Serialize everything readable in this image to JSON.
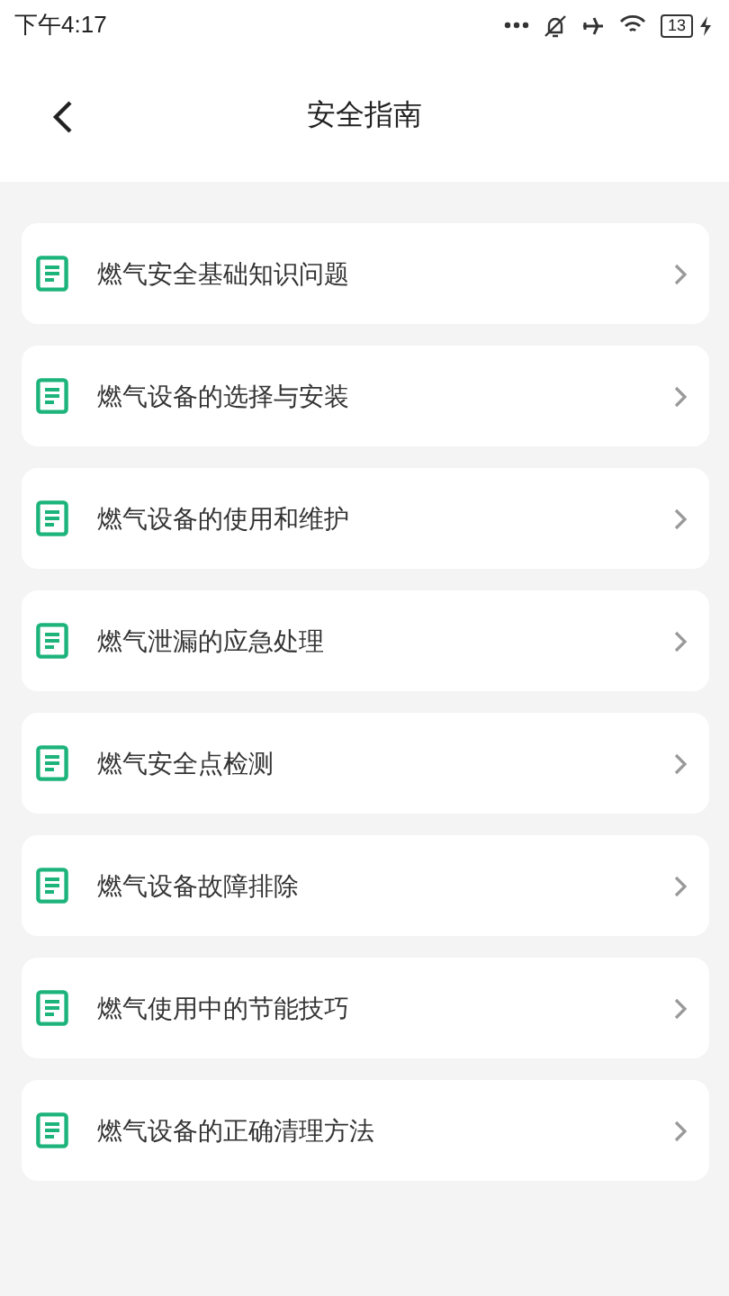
{
  "status_bar": {
    "time": "下午4:17",
    "battery": "13"
  },
  "header": {
    "title": "安全指南"
  },
  "items": [
    {
      "label": "燃气安全基础知识问题"
    },
    {
      "label": "燃气设备的选择与安装"
    },
    {
      "label": "燃气设备的使用和维护"
    },
    {
      "label": "燃气泄漏的应急处理"
    },
    {
      "label": "燃气安全点检测"
    },
    {
      "label": "燃气设备故障排除"
    },
    {
      "label": "燃气使用中的节能技巧"
    },
    {
      "label": "燃气设备的正确清理方法"
    }
  ]
}
